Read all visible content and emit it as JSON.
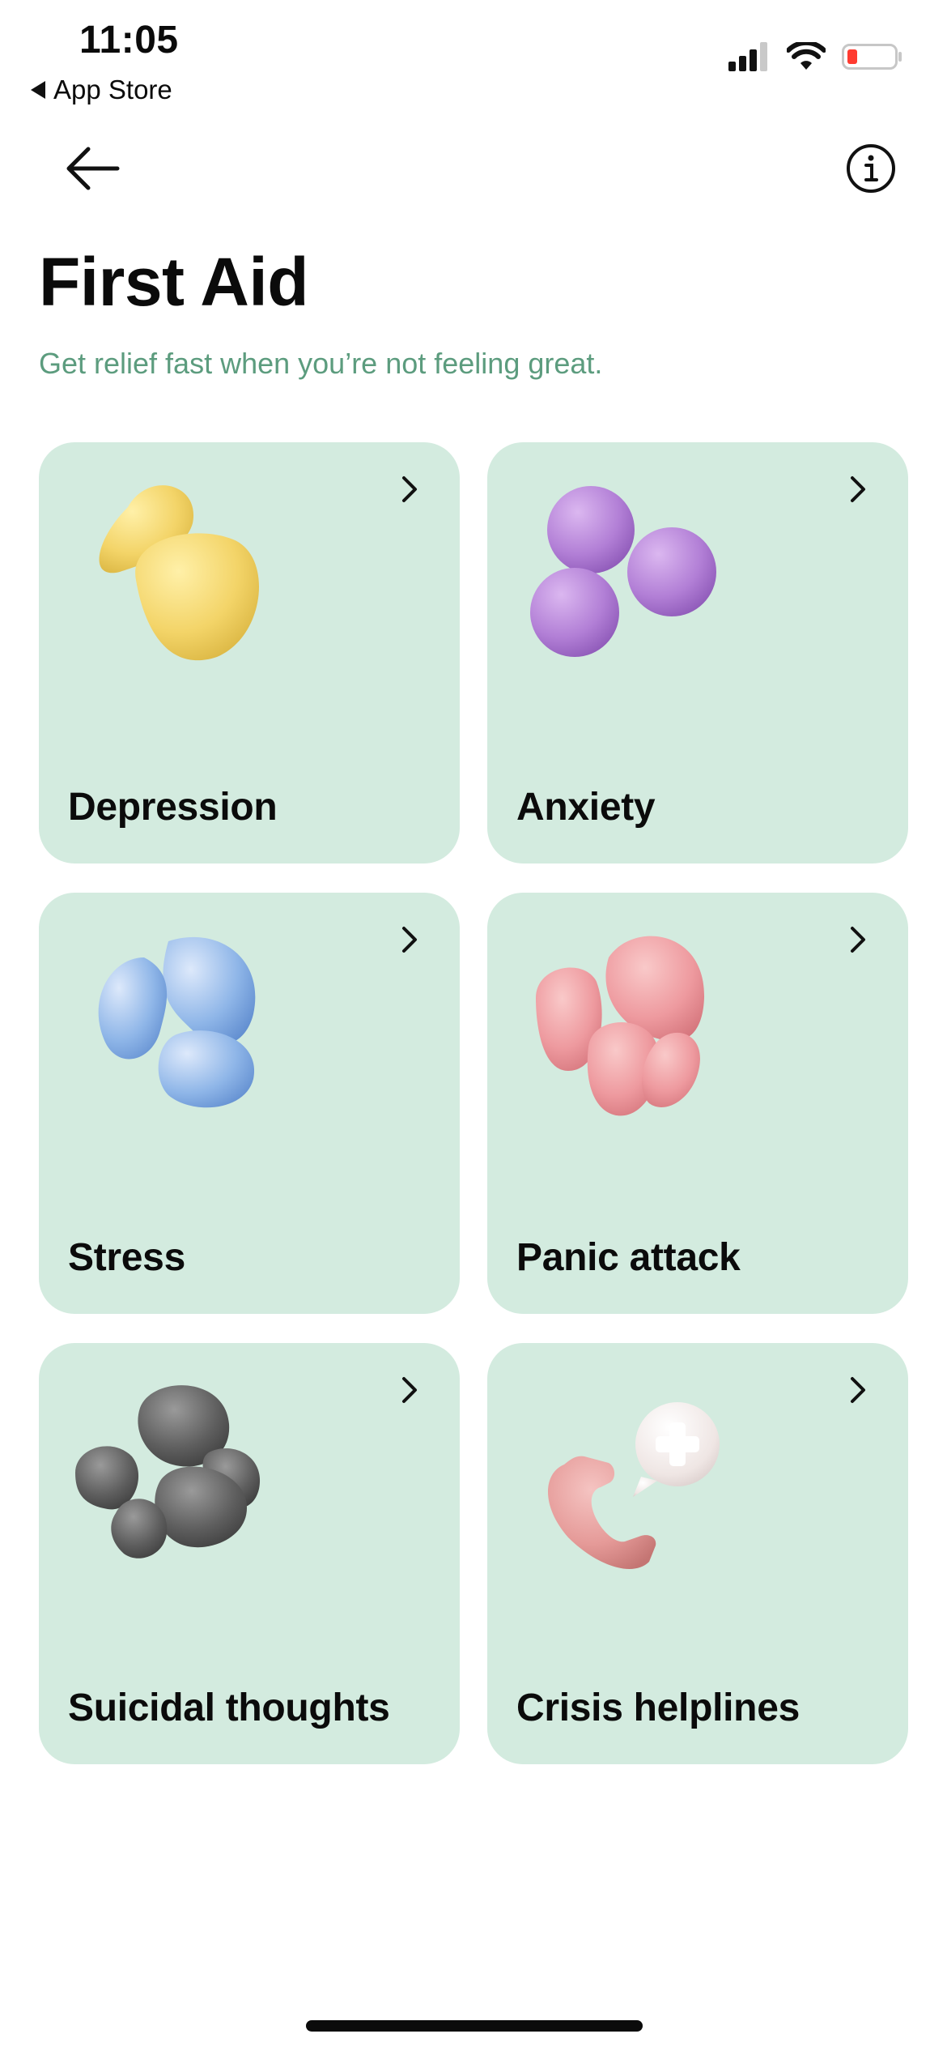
{
  "status_bar": {
    "time": "11:05",
    "back_app": "App Store",
    "icons": [
      "signal-icon",
      "wifi-icon",
      "battery-icon"
    ],
    "battery_color": "#ff3b30"
  },
  "nav": {
    "back_icon": "arrow-left-icon",
    "info_icon": "info-icon"
  },
  "header": {
    "title": "First Aid",
    "subtitle": "Get relief fast when you’re not feeling great."
  },
  "theme": {
    "card_bg": "#d3ebdf",
    "subtitle_color": "#5c9c7e"
  },
  "cards": [
    {
      "label": "Depression",
      "icon": "yellow-blob-icon",
      "color": "#f3d468"
    },
    {
      "label": "Anxiety",
      "icon": "purple-spheres-icon",
      "color": "#b27fd6"
    },
    {
      "label": "Stress",
      "icon": "blue-blob-icon",
      "color": "#8fb6e8"
    },
    {
      "label": "Panic attack",
      "icon": "pink-blob-icon",
      "color": "#ee9a9f"
    },
    {
      "label": "Suicidal thoughts",
      "icon": "gray-rocks-icon",
      "color": "#5e5e5e"
    },
    {
      "label": "Crisis helplines",
      "icon": "phone-plus-icon",
      "color": "#e59a98"
    }
  ]
}
